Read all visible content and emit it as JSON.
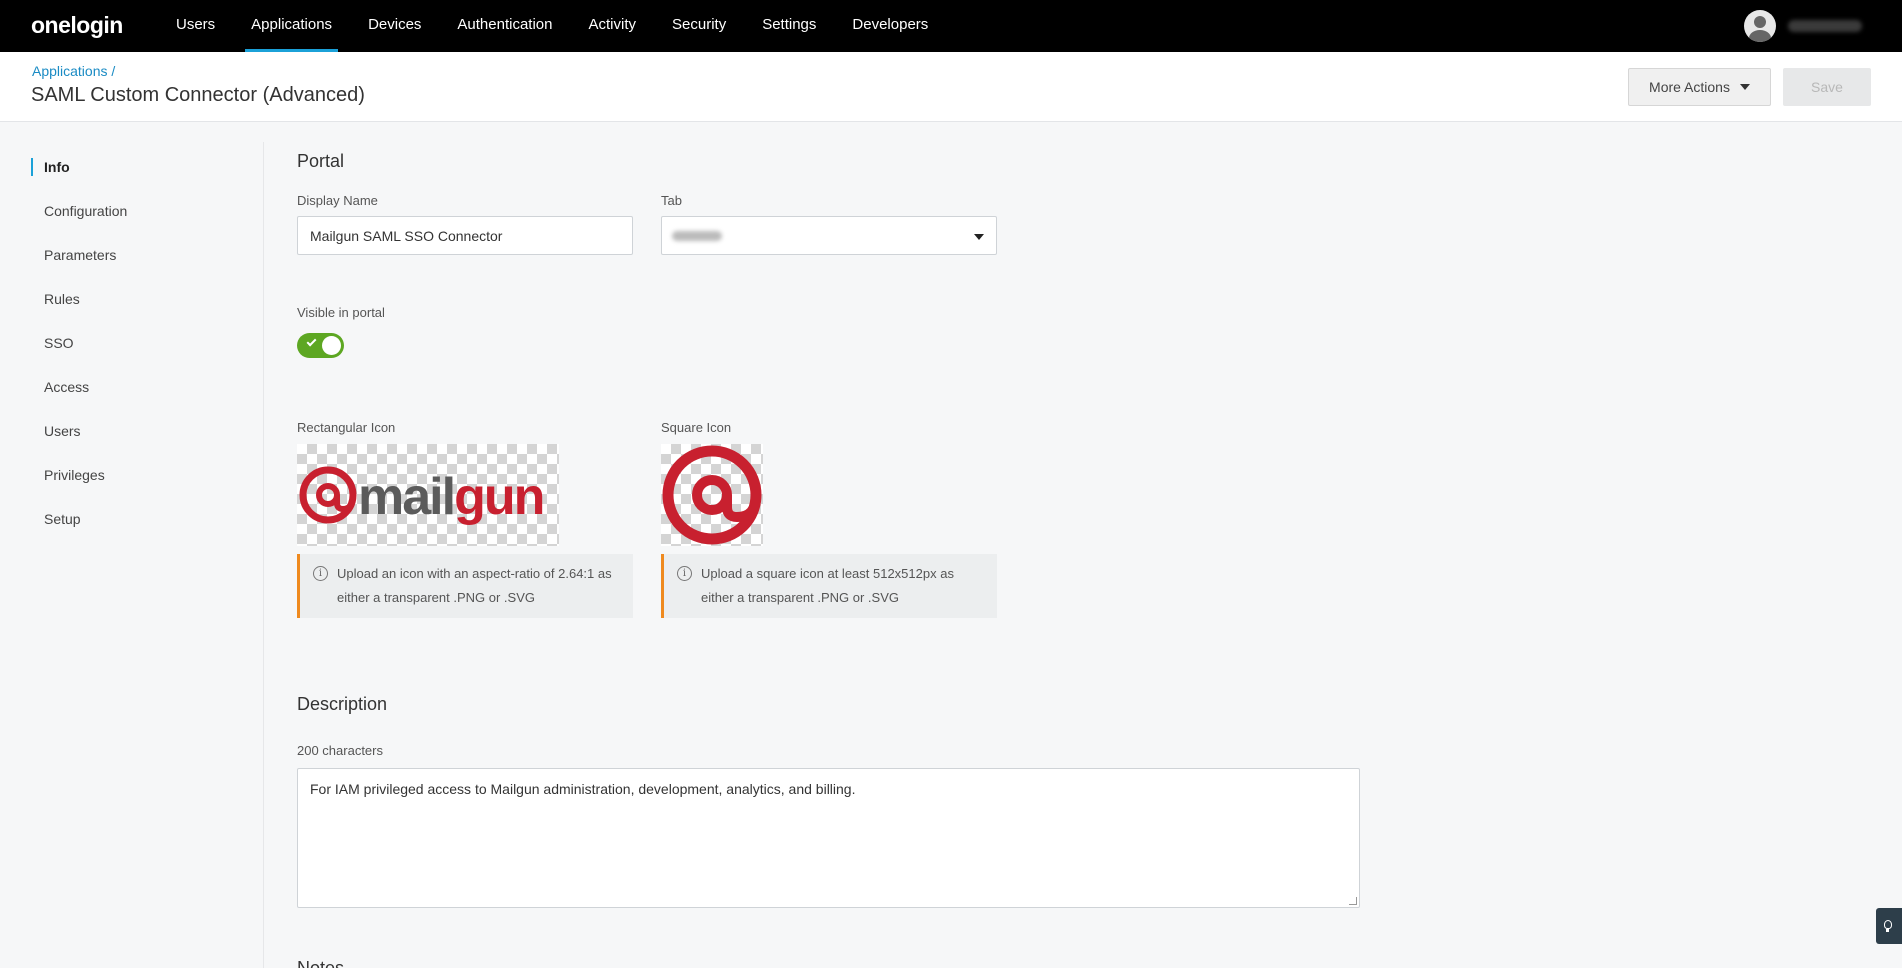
{
  "topnav": {
    "logo": "onelogin",
    "items": [
      "Users",
      "Applications",
      "Devices",
      "Authentication",
      "Activity",
      "Security",
      "Settings",
      "Developers"
    ],
    "active": "Applications",
    "user_icon": "avatar-icon"
  },
  "header": {
    "breadcrumb": "Applications /",
    "title": "SAML Custom Connector (Advanced)",
    "more_actions_label": "More Actions",
    "save_label": "Save"
  },
  "sidebar": {
    "items": [
      "Info",
      "Configuration",
      "Parameters",
      "Rules",
      "SSO",
      "Access",
      "Users",
      "Privileges",
      "Setup"
    ],
    "active": "Info"
  },
  "portal": {
    "section_title": "Portal",
    "display_name_label": "Display Name",
    "display_name_value": "Mailgun SAML SSO Connector",
    "tab_label": "Tab",
    "visible_label": "Visible in portal",
    "visible_on": true,
    "rect_icon_label": "Rectangular Icon",
    "rect_icon_brand": "@mailgun",
    "rect_icon_note": "Upload an icon with an aspect-ratio of 2.64:1 as either a transparent .PNG or .SVG",
    "square_icon_label": "Square Icon",
    "square_icon_note": "Upload a square icon at least 512x512px as either a transparent .PNG or .SVG",
    "brand_color": "#c8202f"
  },
  "description": {
    "section_title": "Description",
    "limit_label": "200 characters",
    "value": "For IAM privileged access to Mailgun administration, development, analytics, and billing."
  },
  "notes": {
    "section_title": "Notes"
  }
}
